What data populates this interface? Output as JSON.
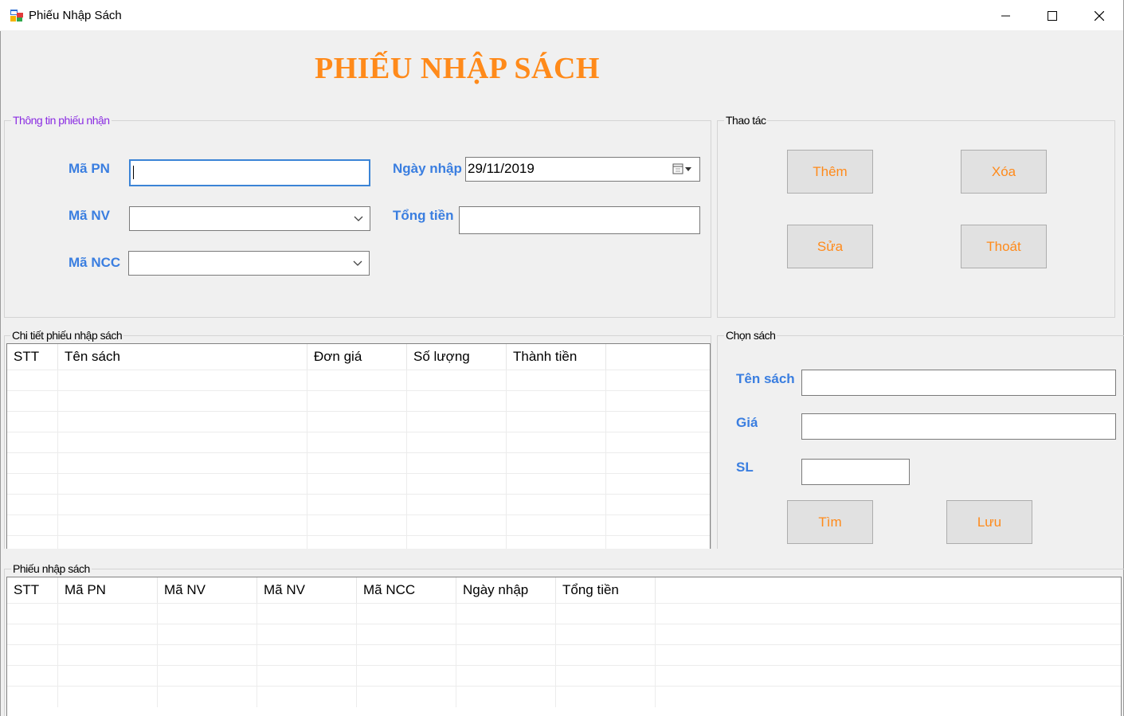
{
  "window": {
    "title": "Phiếu Nhập Sách",
    "icon": "app-form-icon",
    "controls": [
      "minimize-icon",
      "maximize-icon",
      "close-icon"
    ]
  },
  "header": {
    "title": "PHIẾU NHẬP SÁCH"
  },
  "colors": {
    "accent": "#ff8a1a",
    "label_blue": "#3a7ee0",
    "legend_purple": "#8a2be2",
    "focus_border": "#3b84d6"
  },
  "info_group": {
    "legend": "Thông tin phiếu nhận",
    "ma_pn_label": "Mã PN",
    "ma_pn_value": "",
    "ma_nv_label": "Mã NV",
    "ma_nv_value": "",
    "ma_ncc_label": "Mã NCC",
    "ma_ncc_value": "",
    "ngay_nhap_label": "Ngày nhập",
    "ngay_nhap_value": "29/11/2019",
    "tong_tien_label": "Tổng tiền",
    "tong_tien_value": ""
  },
  "actions_group": {
    "legend": "Thao tác",
    "add_label": "Thêm",
    "delete_label": "Xóa",
    "edit_label": "Sửa",
    "exit_label": "Thoát"
  },
  "detail_group": {
    "legend": "Chi tiết phiếu nhập sách",
    "columns": [
      "STT",
      "Tên sách",
      "Đơn giá",
      "Số lượng",
      "Thành tiền"
    ],
    "rows": []
  },
  "choose_book_group": {
    "legend": "Chọn sách",
    "book_name_label": "Tên sách",
    "book_name_value": "",
    "price_label": "Giá",
    "price_value": "",
    "qty_label": "SL",
    "qty_value": "",
    "search_label": "Tìm",
    "save_label": "Lưu"
  },
  "receipts_group": {
    "legend": "Phiếu nhập sách",
    "columns": [
      "STT",
      "Mã PN",
      "Mã NV",
      "Mã NV",
      "Mã NCC",
      "Ngày nhập",
      "Tổng tiền"
    ],
    "rows": []
  }
}
